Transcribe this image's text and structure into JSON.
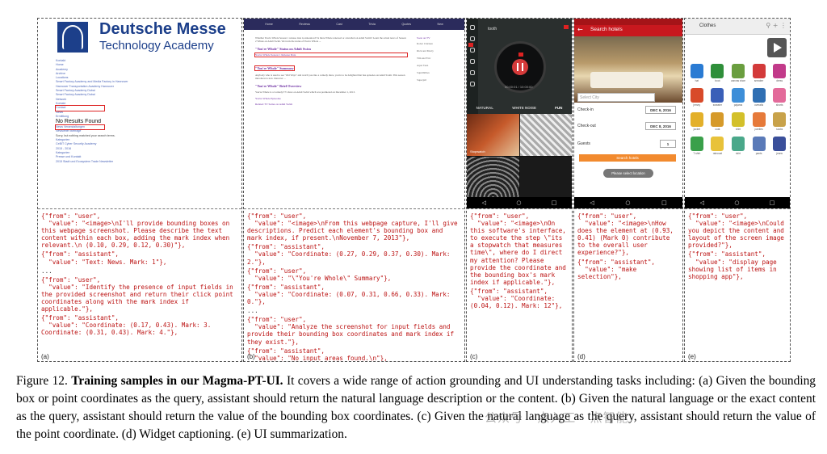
{
  "panels": {
    "a": {
      "label": "(a)",
      "screenshot": {
        "logo_title": "Deutsche Messe",
        "logo_subtitle": "Technology Academy",
        "results_heading": "No Results Found",
        "text_lines": [
          "Kontakt",
          "Home",
          "Academy",
          "Archive",
          "Locations",
          "Smart Factory Academy and Media Factory in Hannover",
          "Hannover Transportation Academy Hannover",
          "Smart Factory Academy Dubai",
          "Smart Factory Academy Dubai",
          "Network",
          "Kontakt",
          "Contact",
          "News",
          "Ermittlung",
          "News Veranstaltungen",
          "Newsletter Beitrage",
          "Sorry, but nothing matched your search terms.",
          "",
          "Kategorien",
          "CeBIT Cyber Security Academy",
          "2015 - 2016",
          "Kategorien",
          "Presse und Kontakt",
          "2015 Stadt und Ecosystem Trade Newsletter"
        ]
      },
      "conversation": [
        {
          "from": "user",
          "value": "<image>\\nI'll provide bounding boxes on this webpage screenshot. Please describe the text content within each box, adding the mark index when relevant.\\n (0.10, 0.29, 0.12, 0.30)"
        },
        {
          "from": "assistant",
          "value": "Text: News. Mark: 1"
        },
        {
          "from": "user",
          "value": "Identify the presence of input fields in the provided screenshot and return their click point coordinates along with the mark index if applicable."
        },
        {
          "from": "assistant",
          "value": "Coordinate: (0.17, 0.43). Mark: 3. Coordinate: (0.31, 0.43). Mark: 4."
        }
      ]
    },
    "b": {
      "label": "(b)",
      "screenshot": {
        "nav": [
          "Home",
          "Reviews",
          "Cast",
          "Trivia",
          "Quotes",
          "New"
        ],
        "headings": [
          "\"You're Whole\" Status on Adult Swim",
          "\"You're Whole\" Summary",
          "\"You're Whole\" Brief Overview"
        ],
        "links": [
          "You're Whole Season 1 Release Date",
          "You're Whole Episodes",
          "Related TV Series on Adult Swim"
        ],
        "side_title": "Soon on TV",
        "side_items": [
          "Robot Chicken",
          "Rick and Morty",
          "Tim and Eric",
          "Aqua Teen",
          "Squidbillies",
          "Superjail"
        ]
      },
      "conversation": [
        {
          "from": "user",
          "value": "<image>\\nFrom this webpage capture, I'll give descriptions. Predict each element's bounding box and mark index, if present.\\nNovember 7, 2013"
        },
        {
          "from": "assistant",
          "value": "Coordinate: (0.27, 0.29, 0.37, 0.30). Mark: 2."
        },
        {
          "from": "user",
          "value": "\\\"You're Whole\\\" Summary"
        },
        {
          "from": "assistant",
          "value": "Coordinate: (0.07, 0.31, 0.66, 0.33). Mark: 0."
        },
        {
          "from": "user",
          "value": "Analyze the screenshot for input fields and provide their bounding box coordinates and mark index if they exist."
        },
        {
          "from": "assistant",
          "value": "No input areas found.\\n"
        }
      ]
    },
    "c": {
      "label": "(c)",
      "screenshot": {
        "header": "tooth",
        "time": "00:00:01 / 10:00:00",
        "tabs": [
          "NATURAL",
          "WHITE NOISE",
          "FUN"
        ],
        "caption": "Stopwatch"
      },
      "conversation": [
        {
          "from": "user",
          "value": "<image>\\nOn this software's interface, to execute the step \\\"its a stopwatch that measures time\\\", where do I direct my attention? Please provide the coordinate and the bounding box's mark index if applicable."
        },
        {
          "from": "assistant",
          "value": "Coordinate: (0.04, 0.12). Mark: 12"
        }
      ]
    },
    "d": {
      "label": "(d)",
      "screenshot": {
        "title": "Search hotels",
        "city_placeholder": "Select City",
        "check_in_label": "Check-in",
        "check_in_value": "DEC 6, 2016",
        "check_out_label": "Check-out",
        "check_out_value": "DEC 8, 2016",
        "guests_label": "Guests",
        "guests_value": "1",
        "search_button": "Search hotels",
        "select_location": "Please select location"
      },
      "conversation": [
        {
          "from": "user",
          "value": "<image>\\nHow does the element at (0.93, 0.41) (Mark 0) contribute to the overall user experience?"
        },
        {
          "from": "assistant",
          "value": "make selection"
        }
      ]
    },
    "e": {
      "label": "(e)",
      "screenshot": {
        "title": "Clothes",
        "items": [
          {
            "name": "hat",
            "color": "#2a7bd3"
          },
          {
            "name": "boot",
            "color": "#2f8f3a"
          },
          {
            "name": "canvas shoe",
            "color": "#6a9e3f"
          },
          {
            "name": "sneaker",
            "color": "#d33a3a"
          },
          {
            "name": "dress",
            "color": "#c23a8a"
          },
          {
            "name": "jersey",
            "color": "#d84a2a"
          },
          {
            "name": "sweater",
            "color": "#3a5fb8"
          },
          {
            "name": "pajama",
            "color": "#3d8ed8"
          },
          {
            "name": "overalls",
            "color": "#2f6fb3"
          },
          {
            "name": "shorts",
            "color": "#e36a9a"
          },
          {
            "name": "jacket",
            "color": "#e3b02a"
          },
          {
            "name": "coat",
            "color": "#d69a2a"
          },
          {
            "name": "shirt",
            "color": "#d3c02a"
          },
          {
            "name": "panties",
            "color": "#e67a3a"
          },
          {
            "name": "socks",
            "color": "#c8a24a"
          },
          {
            "name": "T-shirt",
            "color": "#3aa04a"
          },
          {
            "name": "raincoat",
            "color": "#e8c23a"
          },
          {
            "name": "skirt",
            "color": "#4aa88a"
          },
          {
            "name": "pants",
            "color": "#5a7ab8"
          },
          {
            "name": "jeans",
            "color": "#3a4f9a"
          }
        ]
      },
      "conversation": [
        {
          "from": "user",
          "value": "<image>\\nCould you depict the content and layout of the screen image provided?"
        },
        {
          "from": "assistant",
          "value": "display page showing list of items in shopping app"
        }
      ]
    }
  },
  "caption": {
    "label": "Figure 12.",
    "bold": "Training samples in our Magma-PT-UI.",
    "text": " It covers a wide range of action grounding and UI understanding tasks including: (a) Given the bounding box or point coordinates as the query, assistant should return the natural language description or the content. (b) Given the natural language or the exact content as the query, assistant should return the value of the bounding box coordinates. (c) Given the natural language as the query, assistant should return the value of the point coordinate. (d) Widget captioning. (e) UI summarization."
  },
  "watermark": "公众号 · 点入工 · 点智能"
}
